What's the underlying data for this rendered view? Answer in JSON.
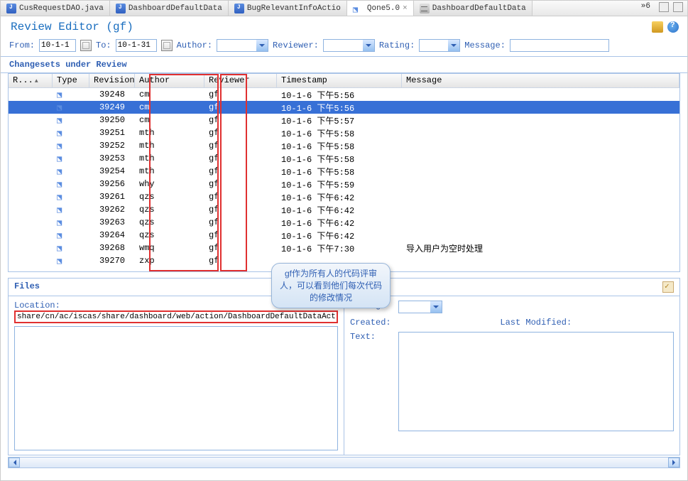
{
  "tabs": [
    {
      "label": "CusRequestDAO.java",
      "type": "java"
    },
    {
      "label": "DashboardDefaultData",
      "type": "java"
    },
    {
      "label": "BugRelevantInfoActio",
      "type": "java"
    },
    {
      "label": "Qone5.0",
      "type": "link",
      "active": true,
      "closable": true
    },
    {
      "label": "DashboardDefaultData",
      "type": "gen"
    }
  ],
  "tabs_overflow": "»6",
  "header": {
    "title": "Review Editor (gf)"
  },
  "filter": {
    "from_label": "From:",
    "from_value": "10-1-1",
    "to_label": "To:",
    "to_value": "10-1-31",
    "author_label": "Author:",
    "author_value": "",
    "reviewer_label": "Reviewer:",
    "reviewer_value": "",
    "rating_label": "Rating:",
    "rating_value": "",
    "message_label": "Message:",
    "message_value": ""
  },
  "changesets": {
    "title": "Changesets under Review",
    "columns": {
      "r": "R...",
      "type": "Type",
      "rev": "Revision",
      "author": "Author",
      "reviewer": "Reviewer",
      "ts": "Timestamp",
      "msg": "Message"
    },
    "rows": [
      {
        "rev": "39248",
        "author": "cm",
        "reviewer": "gf",
        "ts": "10-1-6 下午5:56",
        "msg": ""
      },
      {
        "rev": "39249",
        "author": "cm",
        "reviewer": "gf",
        "ts": "10-1-6 下午5:56",
        "msg": "",
        "selected": true
      },
      {
        "rev": "39250",
        "author": "cm",
        "reviewer": "gf",
        "ts": "10-1-6 下午5:57",
        "msg": ""
      },
      {
        "rev": "39251",
        "author": "mth",
        "reviewer": "gf",
        "ts": "10-1-6 下午5:58",
        "msg": ""
      },
      {
        "rev": "39252",
        "author": "mth",
        "reviewer": "gf",
        "ts": "10-1-6 下午5:58",
        "msg": ""
      },
      {
        "rev": "39253",
        "author": "mth",
        "reviewer": "gf",
        "ts": "10-1-6 下午5:58",
        "msg": ""
      },
      {
        "rev": "39254",
        "author": "mth",
        "reviewer": "gf",
        "ts": "10-1-6 下午5:58",
        "msg": ""
      },
      {
        "rev": "39256",
        "author": "why",
        "reviewer": "gf",
        "ts": "10-1-6 下午5:59",
        "msg": ""
      },
      {
        "rev": "39261",
        "author": "qzs",
        "reviewer": "gf",
        "ts": "10-1-6 下午6:42",
        "msg": ""
      },
      {
        "rev": "39262",
        "author": "qzs",
        "reviewer": "gf",
        "ts": "10-1-6 下午6:42",
        "msg": ""
      },
      {
        "rev": "39263",
        "author": "qzs",
        "reviewer": "gf",
        "ts": "10-1-6 下午6:42",
        "msg": ""
      },
      {
        "rev": "39264",
        "author": "qzs",
        "reviewer": "gf",
        "ts": "10-1-6 下午6:42",
        "msg": ""
      },
      {
        "rev": "39268",
        "author": "wmq",
        "reviewer": "gf",
        "ts": "10-1-6 下午7:30",
        "msg": "导入用户为空时处理"
      },
      {
        "rev": "39270",
        "author": "zxp",
        "reviewer": "gf",
        "ts": "",
        "msg": ""
      }
    ]
  },
  "callout": "gf作为所有人的代码评审人，可以看到他们每次代码的修改情况",
  "files": {
    "title": "Files",
    "location_label": "Location:",
    "location_value": "share/cn/ac/iscas/share/dashboard/web/action/DashboardDefaultDataAction.java",
    "rating_label": "Rating:",
    "rating_value": "",
    "created_label": "Created:",
    "lastmod_label": "Last Modified:",
    "text_label": "Text:"
  }
}
